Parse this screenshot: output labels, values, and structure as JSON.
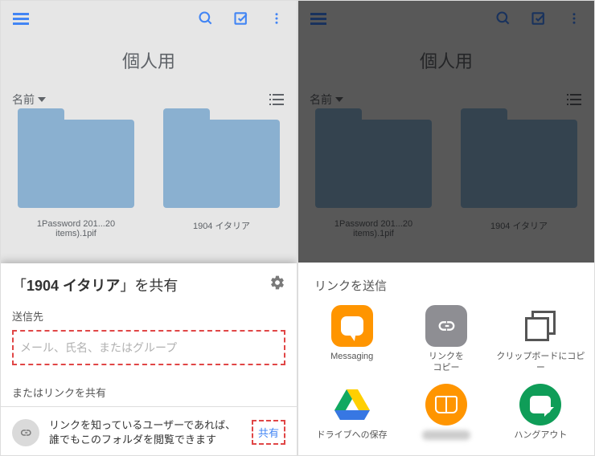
{
  "drive": {
    "title": "個人用",
    "sort_label": "名前",
    "files": [
      {
        "name": "1Password 201...20 items).1pif"
      },
      {
        "name": "1904 イタリア"
      }
    ]
  },
  "share_dialog": {
    "title_prefix": "「",
    "title_name": "1904 イタリア",
    "title_suffix": "」を共有",
    "send_to_label": "送信先",
    "input_placeholder": "メール、氏名、またはグループ",
    "or_link_label": "またはリンクを共有",
    "link_desc": "リンクを知っているユーザーであれば、誰でもこのフォルダを閲覧できます",
    "share_button": "共有"
  },
  "link_send": {
    "title": "リンクを送信",
    "apps": [
      {
        "label": "Messaging",
        "icon": "messaging"
      },
      {
        "label": "リンクを\nコピー",
        "icon": "copylink"
      },
      {
        "label": "クリップボードにコピー",
        "icon": "clipboard"
      },
      {
        "label": "ドライブへの保存",
        "icon": "gdrive"
      },
      {
        "label": "",
        "icon": "books"
      },
      {
        "label": "ハングアウト",
        "icon": "hangouts"
      }
    ]
  }
}
